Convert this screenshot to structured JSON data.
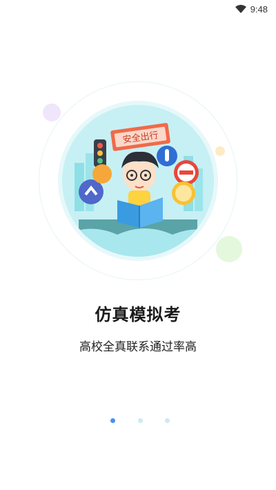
{
  "status_bar": {
    "time": "9:48"
  },
  "hero": {
    "sign_text": "安全出行"
  },
  "onboarding": {
    "title": "仿真模拟考",
    "subtitle": "高校全真联系通过率高"
  },
  "pager": {
    "total_pages": 3,
    "active_page": 1
  },
  "colors": {
    "accent": "#4a90f5",
    "dot_inactive": "#cfe9ef",
    "circle_bg": "#c7f0f4"
  }
}
